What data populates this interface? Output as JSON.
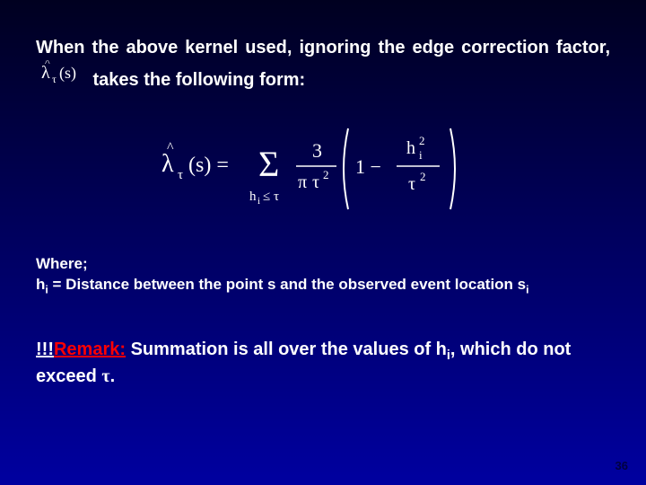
{
  "para1_a": "When the above kernel used, ignoring the edge correction factor,",
  "para1_b": "takes the following form:",
  "where_label": "Where;",
  "where_line_a": "h",
  "where_line_b": "i",
  "where_line_c": " = Distance between the point s and the observed event location s",
  "where_line_d": "i",
  "remark_prefix": "!!!",
  "remark_word": "Remark:",
  "remark_a": " Summation is all over the values of h",
  "remark_b": "i",
  "remark_c": ", which do not exceed ",
  "remark_d": "τ",
  "remark_e": ".",
  "pagenum": "36",
  "formula": {
    "lhs_lam": "λ",
    "lhs_hat": "^",
    "lhs_tau": "τ",
    "lhs_arg": "(s) =",
    "sigma": "Σ",
    "cond_h": "h",
    "cond_i": "i",
    "cond_rel": " ≤ τ",
    "num3": "3",
    "pi": "π",
    "t2": "τ",
    "sq": "2",
    "one": "1 −",
    "hi": "h",
    "hi_i": "i"
  },
  "inline": {
    "lam": "λ",
    "hat": "^",
    "tau": "τ",
    "arg": "(s)"
  }
}
